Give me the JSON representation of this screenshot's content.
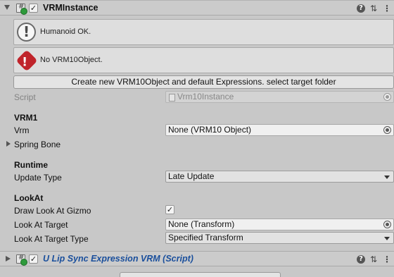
{
  "component": {
    "title": "VRMInstance",
    "enabled": true,
    "icons": [
      "help-icon",
      "preset-icon",
      "more-icon"
    ]
  },
  "helpboxes": {
    "info": {
      "icon": "info-icon",
      "message": "Humanoid OK."
    },
    "error": {
      "icon": "error-icon",
      "message": "No VRM10Object."
    }
  },
  "create_button": "Create new VRM10Object and default Expressions. select target folder",
  "script": {
    "label": "Script",
    "value": "Vrm10Instance"
  },
  "vrm1": {
    "header": "VRM1",
    "vrm_label": "Vrm",
    "vrm_value": "None (VRM10 Object)",
    "spring_bone_label": "Spring Bone"
  },
  "runtime": {
    "header": "Runtime",
    "update_type_label": "Update Type",
    "update_type_value": "Late Update"
  },
  "lookat": {
    "header": "LookAt",
    "draw_gizmo_label": "Draw Look At Gizmo",
    "draw_gizmo_checked": true,
    "target_label": "Look At Target",
    "target_value": "None (Transform)",
    "target_type_label": "Look At Target Type",
    "target_type_value": "Specified Transform"
  },
  "component2": {
    "title": "U Lip Sync Expression VRM (Script)",
    "enabled": true
  },
  "colors": {
    "background": "#c8c8c8",
    "error_red": "#c0242b",
    "script_title_blue": "#1a4f9c"
  }
}
